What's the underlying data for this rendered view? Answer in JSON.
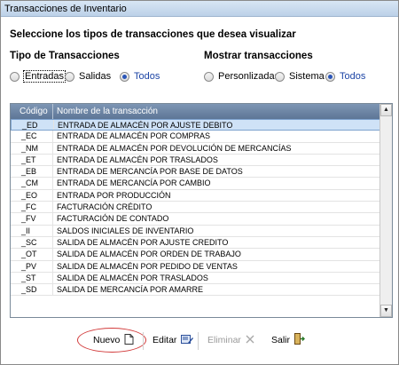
{
  "window": {
    "title": "Transacciones de Inventario"
  },
  "heading": "Seleccione los tipos de transacciones que desea visualizar",
  "tipo": {
    "title": "Tipo de Transacciones",
    "options": [
      {
        "label": "Entradas",
        "selected": false
      },
      {
        "label": "Salidas",
        "selected": false
      },
      {
        "label": "Todos",
        "selected": true
      }
    ]
  },
  "mostrar": {
    "title": "Mostrar transacciones",
    "options": [
      {
        "label": "Personlizadas",
        "selected": false
      },
      {
        "label": "Sistema",
        "selected": false
      },
      {
        "label": "Todos",
        "selected": true
      }
    ]
  },
  "grid": {
    "headers": {
      "code": "Código",
      "name": "Nombre de la transacción"
    },
    "rows": [
      {
        "code": "_ED",
        "name": "ENTRADA DE ALMACÉN POR AJUSTE DEBITO"
      },
      {
        "code": "_EC",
        "name": "ENTRADA DE ALMACÉN POR COMPRAS"
      },
      {
        "code": "_NM",
        "name": "ENTRADA DE ALMACÉN POR DEVOLUCIÓN DE MERCANCÍAS"
      },
      {
        "code": "_ET",
        "name": "ENTRADA DE ALMACÉN POR TRASLADOS"
      },
      {
        "code": "_EB",
        "name": "ENTRADA DE MERCANCÍA POR BASE DE DATOS"
      },
      {
        "code": "_CM",
        "name": "ENTRADA DE MERCANCÍA POR CAMBIO"
      },
      {
        "code": "_EO",
        "name": "ENTRADA POR PRODUCCIÓN"
      },
      {
        "code": "_FC",
        "name": "FACTURACIÓN CRÉDITO"
      },
      {
        "code": "_FV",
        "name": "FACTURACIÓN DE CONTADO"
      },
      {
        "code": "_II",
        "name": "SALDOS INICIALES DE INVENTARIO"
      },
      {
        "code": "_SC",
        "name": "SALIDA DE ALMACÉN POR AJUSTE CREDITO"
      },
      {
        "code": "_OT",
        "name": "SALIDA DE ALMACÉN POR ORDEN DE TRABAJO"
      },
      {
        "code": "_PV",
        "name": "SALIDA DE ALMACÉN POR PEDIDO DE VENTAS"
      },
      {
        "code": "_ST",
        "name": "SALIDA DE ALMACÉN POR TRASLADOS"
      },
      {
        "code": "_SD",
        "name": "SALIDA DE MERCANCÍA POR AMARRE"
      }
    ]
  },
  "toolbar": {
    "nuevo": "Nuevo",
    "editar": "Editar",
    "eliminar": "Eliminar",
    "salir": "Salir"
  },
  "colors": {
    "header": "#6b84a4",
    "selected_row": "#cfe2f7",
    "highlight": "#d23b3b",
    "link": "#1c44a5"
  }
}
